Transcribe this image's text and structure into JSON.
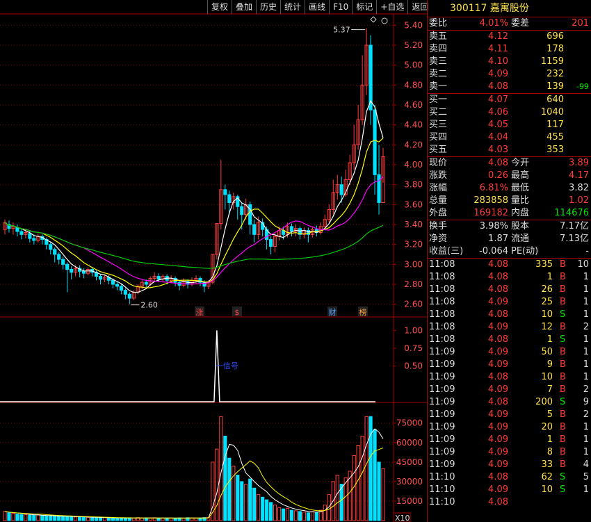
{
  "toolbar": [
    "复权",
    "叠加",
    "历史",
    "统计",
    "画线",
    "F10",
    "标记",
    "+自选",
    "返回"
  ],
  "stock": {
    "code": "300117",
    "name": "嘉寓股份"
  },
  "weibi": {
    "label1": "委比",
    "value1": "4.01%",
    "label2": "委差",
    "value2": "201"
  },
  "asks": [
    {
      "label": "卖五",
      "price": "4.12",
      "vol": "696",
      "chg": ""
    },
    {
      "label": "卖四",
      "price": "4.11",
      "vol": "178",
      "chg": ""
    },
    {
      "label": "卖三",
      "price": "4.10",
      "vol": "1159",
      "chg": ""
    },
    {
      "label": "卖二",
      "price": "4.09",
      "vol": "232",
      "chg": ""
    },
    {
      "label": "卖一",
      "price": "4.08",
      "vol": "139",
      "chg": "-99"
    }
  ],
  "bids": [
    {
      "label": "买一",
      "price": "4.07",
      "vol": "640"
    },
    {
      "label": "买二",
      "price": "4.06",
      "vol": "1040"
    },
    {
      "label": "买三",
      "price": "4.05",
      "vol": "117"
    },
    {
      "label": "买四",
      "price": "4.04",
      "vol": "455"
    },
    {
      "label": "买五",
      "price": "4.03",
      "vol": "353"
    }
  ],
  "quote": [
    {
      "l1": "现价",
      "v1": "4.08",
      "c1": "red",
      "l2": "今开",
      "v2": "3.89",
      "c2": "red"
    },
    {
      "l1": "涨跌",
      "v1": "0.26",
      "c1": "red",
      "l2": "最高",
      "v2": "4.17",
      "c2": "red"
    },
    {
      "l1": "涨幅",
      "v1": "6.81%",
      "c1": "red",
      "l2": "最低",
      "v2": "3.82",
      "c2": "wht"
    },
    {
      "l1": "总量",
      "v1": "283858",
      "c1": "yel",
      "l2": "量比",
      "v2": "1.02",
      "c2": "red"
    },
    {
      "l1": "外盘",
      "v1": "169182",
      "c1": "red",
      "l2": "内盘",
      "v2": "114676",
      "c2": "grn"
    }
  ],
  "fundamentals": [
    {
      "l1": "换手",
      "v1": "3.98%",
      "l2": "股本",
      "v2": "7.17亿"
    },
    {
      "l1": "净资",
      "v1": "1.87",
      "l2": "流通",
      "v2": "7.13亿"
    },
    {
      "l1": "收益(三)",
      "v1": "-0.064",
      "l2": "PE(动)",
      "v2": "-"
    }
  ],
  "ticks": [
    {
      "t": "11:08",
      "p": "4.08",
      "v": "335",
      "s": "B",
      "n": "10",
      "pc": "red"
    },
    {
      "t": "11:08",
      "p": "4.08",
      "v": "1",
      "s": "B",
      "n": "1",
      "pc": "red"
    },
    {
      "t": "11:08",
      "p": "4.08",
      "v": "26",
      "s": "B",
      "n": "1",
      "pc": "red"
    },
    {
      "t": "11:08",
      "p": "4.09",
      "v": "25",
      "s": "B",
      "n": "1",
      "pc": "red"
    },
    {
      "t": "11:08",
      "p": "4.08",
      "v": "10",
      "s": "S",
      "n": "1",
      "pc": "red"
    },
    {
      "t": "11:08",
      "p": "4.09",
      "v": "12",
      "s": "B",
      "n": "2",
      "pc": "red"
    },
    {
      "t": "11:08",
      "p": "4.08",
      "v": "1",
      "s": "S",
      "n": "1",
      "pc": "red"
    },
    {
      "t": "11:09",
      "p": "4.09",
      "v": "50",
      "s": "B",
      "n": "1",
      "pc": "red"
    },
    {
      "t": "11:09",
      "p": "4.09",
      "v": "9",
      "s": "B",
      "n": "1",
      "pc": "red"
    },
    {
      "t": "11:09",
      "p": "4.08",
      "v": "10",
      "s": "B",
      "n": "1",
      "pc": "red"
    },
    {
      "t": "11:09",
      "p": "4.09",
      "v": "7",
      "s": "B",
      "n": "2",
      "pc": "red"
    },
    {
      "t": "11:09",
      "p": "4.08",
      "v": "200",
      "s": "S",
      "n": "9",
      "pc": "red"
    },
    {
      "t": "11:09",
      "p": "4.09",
      "v": "5",
      "s": "B",
      "n": "2",
      "pc": "red"
    },
    {
      "t": "11:09",
      "p": "4.09",
      "v": "20",
      "s": "B",
      "n": "1",
      "pc": "red"
    },
    {
      "t": "11:09",
      "p": "4.09",
      "v": "1",
      "s": "B",
      "n": "1",
      "pc": "red"
    },
    {
      "t": "11:09",
      "p": "4.09",
      "v": "8",
      "s": "B",
      "n": "1",
      "pc": "red"
    },
    {
      "t": "11:09",
      "p": "4.09",
      "v": "33",
      "s": "B",
      "n": "4",
      "pc": "red"
    },
    {
      "t": "11:10",
      "p": "4.08",
      "v": "62",
      "s": "S",
      "n": "5",
      "pc": "red"
    },
    {
      "t": "11:10",
      "p": "4.09",
      "v": "10",
      "s": "S",
      "n": "1",
      "pc": "red"
    },
    {
      "t": "11:10",
      "p": "4.08",
      "v": "",
      "s": "",
      "n": "",
      "pc": "red"
    }
  ],
  "chart_data": [
    {
      "type": "candlestick",
      "ylim": [
        2.5,
        5.5
      ],
      "yticks": [
        "5.40",
        "5.20",
        "5.00",
        "4.80",
        "4.60",
        "4.40",
        "4.20",
        "4.00",
        "3.80",
        "3.60",
        "3.40",
        "3.20",
        "3.00",
        "2.80",
        "2.60"
      ],
      "annotations": {
        "high": "5.37",
        "low": "2.60"
      },
      "markers": [
        "涨",
        "$",
        "财",
        "榜"
      ],
      "candles": [
        [
          3.35,
          3.42,
          3.3,
          3.45
        ],
        [
          3.4,
          3.36,
          3.32,
          3.44
        ],
        [
          3.36,
          3.38,
          3.3,
          3.42
        ],
        [
          3.37,
          3.33,
          3.28,
          3.4
        ],
        [
          3.33,
          3.3,
          3.25,
          3.36
        ],
        [
          3.3,
          3.32,
          3.26,
          3.35
        ],
        [
          3.31,
          3.26,
          3.22,
          3.34
        ],
        [
          3.26,
          3.24,
          3.2,
          3.3
        ],
        [
          3.24,
          3.28,
          3.22,
          3.31
        ],
        [
          3.28,
          3.25,
          3.2,
          3.3
        ],
        [
          3.25,
          3.2,
          3.15,
          3.27
        ],
        [
          3.2,
          3.15,
          3.1,
          3.22
        ],
        [
          3.15,
          3.1,
          3.02,
          3.17
        ],
        [
          3.1,
          3.05,
          3.0,
          3.12
        ],
        [
          3.05,
          3.0,
          2.95,
          3.08
        ],
        [
          3.0,
          2.95,
          2.72,
          3.02
        ],
        [
          2.95,
          2.92,
          2.85,
          2.98
        ],
        [
          2.92,
          2.96,
          2.88,
          2.99
        ],
        [
          2.96,
          2.93,
          2.87,
          2.99
        ],
        [
          2.93,
          2.91,
          2.86,
          2.96
        ],
        [
          2.91,
          2.95,
          2.89,
          2.97
        ],
        [
          2.95,
          2.92,
          2.88,
          2.97
        ],
        [
          2.92,
          2.88,
          2.84,
          2.94
        ],
        [
          2.88,
          2.85,
          2.8,
          2.9
        ],
        [
          2.85,
          2.87,
          2.82,
          2.9
        ],
        [
          2.87,
          2.84,
          2.8,
          2.89
        ],
        [
          2.84,
          2.8,
          2.76,
          2.86
        ],
        [
          2.8,
          2.78,
          2.74,
          2.83
        ],
        [
          2.78,
          2.74,
          2.7,
          2.8
        ],
        [
          2.74,
          2.7,
          2.65,
          2.76
        ],
        [
          2.7,
          2.66,
          2.6,
          2.72
        ],
        [
          2.66,
          2.72,
          2.64,
          2.74
        ],
        [
          2.72,
          2.78,
          2.7,
          2.8
        ],
        [
          2.78,
          2.82,
          2.75,
          2.84
        ],
        [
          2.82,
          2.8,
          2.76,
          2.85
        ],
        [
          2.8,
          2.86,
          2.78,
          2.88
        ],
        [
          2.86,
          2.88,
          2.83,
          2.92
        ],
        [
          2.88,
          2.85,
          2.82,
          2.91
        ],
        [
          2.85,
          2.88,
          2.83,
          2.9
        ],
        [
          2.88,
          2.84,
          2.8,
          2.9
        ],
        [
          2.84,
          2.86,
          2.81,
          2.89
        ],
        [
          2.86,
          2.82,
          2.78,
          2.88
        ],
        [
          2.82,
          2.79,
          2.74,
          2.84
        ],
        [
          2.79,
          2.83,
          2.77,
          2.86
        ],
        [
          2.83,
          2.8,
          2.76,
          2.85
        ],
        [
          2.8,
          2.84,
          2.78,
          2.87
        ],
        [
          2.84,
          2.86,
          2.81,
          2.89
        ],
        [
          2.86,
          2.82,
          2.78,
          2.88
        ],
        [
          2.82,
          2.78,
          2.72,
          2.84
        ],
        [
          2.78,
          2.82,
          2.75,
          2.84
        ],
        [
          2.82,
          3.1,
          2.8,
          3.1
        ],
        [
          3.1,
          3.41,
          3.05,
          3.41
        ],
        [
          3.41,
          3.75,
          3.35,
          4.05
        ],
        [
          3.75,
          3.7,
          3.55,
          3.8
        ],
        [
          3.7,
          3.62,
          3.5,
          3.74
        ],
        [
          3.62,
          3.68,
          3.55,
          3.72
        ],
        [
          3.68,
          3.58,
          3.45,
          3.7
        ],
        [
          3.58,
          3.5,
          3.35,
          3.62
        ],
        [
          3.5,
          3.6,
          3.45,
          3.66
        ],
        [
          3.6,
          3.4,
          3.3,
          3.63
        ],
        [
          3.4,
          3.3,
          3.22,
          3.45
        ],
        [
          3.3,
          3.42,
          3.25,
          3.48
        ],
        [
          3.42,
          3.35,
          3.28,
          3.46
        ],
        [
          3.35,
          3.25,
          3.15,
          3.38
        ],
        [
          3.25,
          3.18,
          3.1,
          3.28
        ],
        [
          3.18,
          3.28,
          3.12,
          3.32
        ],
        [
          3.28,
          3.34,
          3.24,
          3.38
        ],
        [
          3.34,
          3.3,
          3.25,
          3.38
        ],
        [
          3.3,
          3.38,
          3.27,
          3.42
        ],
        [
          3.38,
          3.33,
          3.28,
          3.41
        ],
        [
          3.33,
          3.36,
          3.28,
          3.4
        ],
        [
          3.36,
          3.3,
          3.25,
          3.38
        ],
        [
          3.3,
          3.34,
          3.26,
          3.37
        ],
        [
          3.34,
          3.3,
          3.22,
          3.37
        ],
        [
          3.3,
          3.35,
          3.27,
          3.38
        ],
        [
          3.35,
          3.32,
          3.28,
          3.39
        ],
        [
          3.32,
          3.38,
          3.3,
          3.42
        ],
        [
          3.38,
          3.45,
          3.35,
          3.5
        ],
        [
          3.45,
          3.55,
          3.42,
          3.6
        ],
        [
          3.55,
          3.72,
          3.5,
          3.85
        ],
        [
          3.72,
          3.8,
          3.65,
          3.9
        ],
        [
          3.8,
          3.7,
          3.62,
          3.88
        ],
        [
          3.7,
          3.85,
          3.68,
          3.95
        ],
        [
          3.85,
          4.02,
          3.8,
          4.1
        ],
        [
          4.02,
          4.2,
          3.95,
          4.4
        ],
        [
          4.2,
          4.45,
          4.15,
          4.6
        ],
        [
          4.45,
          4.8,
          4.4,
          5.1
        ],
        [
          4.8,
          5.2,
          4.7,
          5.37
        ],
        [
          5.2,
          4.55,
          4.4,
          5.3
        ],
        [
          4.55,
          3.9,
          3.7,
          4.6
        ],
        [
          3.9,
          3.62,
          3.5,
          4.2
        ],
        [
          3.62,
          4.08,
          3.82,
          4.17
        ]
      ],
      "ma": [
        {
          "name": "MA5",
          "color": "#ffffff"
        },
        {
          "name": "MA10",
          "color": "#ffff00"
        },
        {
          "name": "MA20",
          "color": "#ff00ff"
        },
        {
          "name": "MA60",
          "color": "#00cc00"
        }
      ]
    },
    {
      "type": "line",
      "ylim": [
        0,
        1.1
      ],
      "yticks": [
        "1.00",
        "0.75",
        "0.50"
      ],
      "label": "一信号",
      "spike_index": 51
    },
    {
      "type": "bar",
      "ylim": [
        0,
        85000
      ],
      "yticks": [
        "75000",
        "60000",
        "45000",
        "30000",
        "15000"
      ],
      "unit": "X10",
      "volumes": [
        7000,
        6000,
        5500,
        5000,
        4800,
        4500,
        4200,
        4000,
        4300,
        3800,
        3600,
        3500,
        3400,
        3300,
        3200,
        3500,
        3000,
        2800,
        2600,
        2700,
        2500,
        2400,
        2300,
        2200,
        2400,
        2100,
        2000,
        1900,
        2100,
        1800,
        2200,
        2000,
        2300,
        1900,
        2100,
        2000,
        2200,
        1800,
        2000,
        1900,
        2100,
        1800,
        2000,
        1900,
        2200,
        2100,
        2000,
        1800,
        2300,
        2500,
        45000,
        55000,
        80000,
        65000,
        48000,
        42000,
        35000,
        30000,
        28000,
        32000,
        25000,
        20000,
        18000,
        16000,
        14000,
        12000,
        10000,
        9000,
        9500,
        8000,
        7500,
        7000,
        6500,
        6000,
        7000,
        6500,
        8000,
        12000,
        20000,
        30000,
        35000,
        28000,
        33000,
        38000,
        50000,
        58000,
        65000,
        80000,
        80000,
        70000,
        45000,
        40000
      ]
    }
  ]
}
